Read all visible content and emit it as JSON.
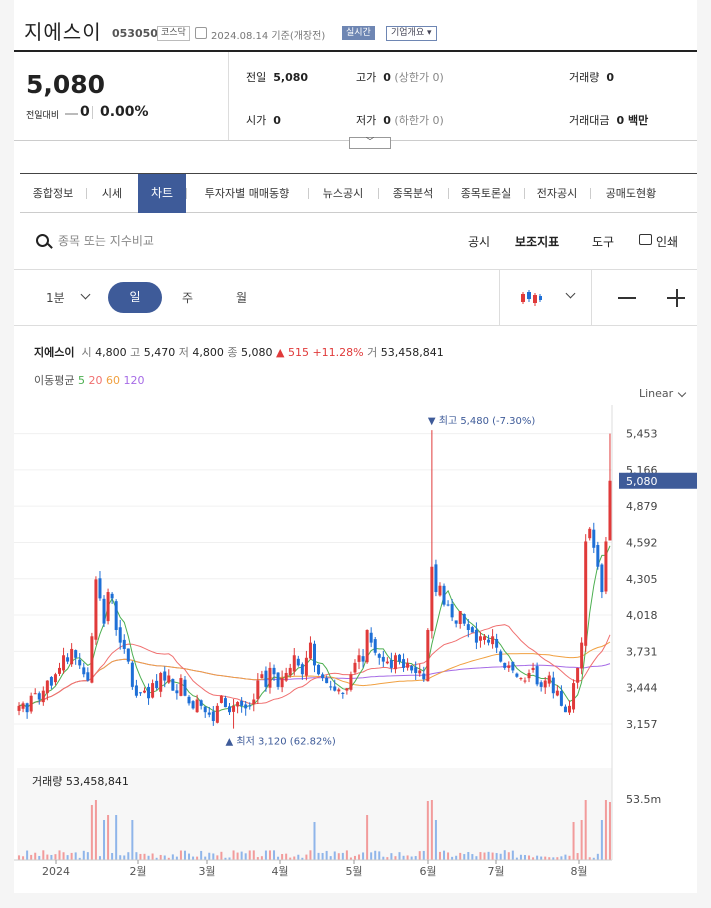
{
  "stock": {
    "name": "지에스이",
    "code": "053050",
    "market": "코스닥",
    "date": "2024.08.14 기준(개장전)",
    "realtime": "실시간",
    "company_info": "기업개요"
  },
  "quote": {
    "price": "5,080",
    "change_label": "전일대비",
    "change": "0",
    "change_pct": "0.00%",
    "prev_label": "전일",
    "prev": "5,080",
    "open_label": "시가",
    "open": "0",
    "high_label": "고가",
    "high": "0",
    "upper_limit": "(상한가 0)",
    "low_label": "저가",
    "low": "0",
    "lower_limit": "(하한가 0)",
    "volume_label": "거래량",
    "volume": "0",
    "amount_label": "거래대금",
    "amount": "0 백만"
  },
  "tabs": [
    "종합정보",
    "시세",
    "차트",
    "투자자별 매매동향",
    "뉴스공시",
    "종목분석",
    "종목토론실",
    "전자공시",
    "공매도현황"
  ],
  "active_tab": "차트",
  "search": {
    "placeholder": "종목 또는 지수비교"
  },
  "tools": {
    "notice": "공시",
    "indicator": "보조지표",
    "tool": "도구",
    "print": "인쇄"
  },
  "periods": {
    "minute": "1분",
    "day": "일",
    "week": "주",
    "month": "월"
  },
  "colors": {
    "up": "#e03a3a",
    "down": "#1e6fd6",
    "active": "#3e5b99",
    "ma5": "#4caf50",
    "ma20": "#f07070",
    "ma60": "#f0a040",
    "ma120": "#a66be6"
  },
  "chart_info": {
    "name": "지에스이",
    "open_label": "시",
    "open": "4,800",
    "high_label": "고",
    "high": "5,470",
    "low_label": "저",
    "low": "4,800",
    "close_label": "종",
    "close": "5,080",
    "change": "▲ 515",
    "change_pct": "+11.28%",
    "volume_label": "거",
    "volume": "53,458,841"
  },
  "ma_legend": {
    "label": "이동평균",
    "p5": "5",
    "p20": "20",
    "p60": "60",
    "p120": "120"
  },
  "scale": "Linear",
  "chart_data": {
    "type": "candlestick",
    "y_ticks": [
      "5,453",
      "5,166",
      "4,879",
      "4,592",
      "4,305",
      "4,018",
      "3,731",
      "3,444",
      "3,157"
    ],
    "ylim": [
      3030,
      5600
    ],
    "x_ticks": [
      "2024",
      "2월",
      "3월",
      "4월",
      "5월",
      "6월",
      "7월",
      "8월"
    ],
    "current_price_label": "5,080",
    "max_annotation": "▼ 최고 5,480 (-7.30%)",
    "min_annotation": "▲ 최저 3,120 (62.82%)",
    "volume_label": "거래량",
    "volume_value": "53,458,841",
    "volume_axis_max": "53.5m",
    "close_approx": [
      3300,
      3320,
      3250,
      3380,
      3400,
      3350,
      3420,
      3500,
      3460,
      3550,
      3600,
      3700,
      3650,
      3750,
      3680,
      3620,
      3550,
      3500,
      3850,
      4300,
      4150,
      3950,
      4200,
      4150,
      3900,
      3800,
      3750,
      3650,
      3450,
      3380,
      3400,
      3420,
      3360,
      3480,
      3440,
      3560,
      3500,
      3540,
      3420,
      3400,
      3520,
      3380,
      3320,
      3280,
      3350,
      3300,
      3250,
      3230,
      3180,
      3300,
      3380,
      3290,
      3250,
      3300,
      3330,
      3300,
      3280,
      3300,
      3350,
      3500,
      3550,
      3450,
      3600,
      3550,
      3450,
      3520,
      3560,
      3600,
      3700,
      3620,
      3550,
      3680,
      3800,
      3620,
      3550,
      3520,
      3480,
      3450,
      3420,
      3430,
      3400,
      3440,
      3550,
      3640,
      3700,
      3650,
      3900,
      3800,
      3720,
      3680,
      3650,
      3650,
      3600,
      3700,
      3650,
      3600,
      3640,
      3580,
      3560,
      3580,
      3510,
      3900,
      4400,
      4200,
      4250,
      4100,
      4100,
      4000,
      3950,
      4050,
      3950,
      3900,
      3880,
      3800,
      3850,
      3850,
      3800,
      3850,
      3760,
      3650,
      3600,
      3620,
      3580,
      3530,
      3520,
      3500,
      3560,
      3600,
      3470,
      3450,
      3500,
      3540,
      3400,
      3420,
      3300,
      3250,
      3300,
      3480,
      3600,
      3800,
      4600,
      4700,
      4550,
      4400,
      4200,
      4600,
      5080
    ]
  }
}
